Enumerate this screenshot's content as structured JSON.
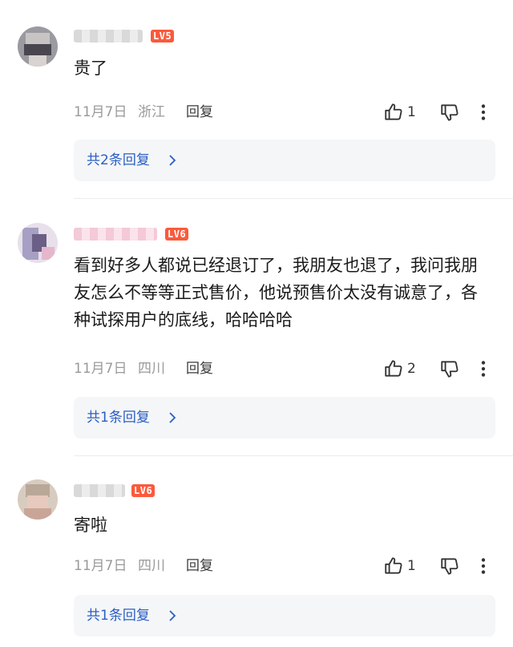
{
  "comments": [
    {
      "level_badge": "LV5",
      "text": "贵了",
      "date": "11月7日",
      "location": "浙江",
      "reply_label": "回复",
      "likes": "1",
      "replies_summary": "共2条回复"
    },
    {
      "level_badge": "LV6",
      "text": "看到好多人都说已经退订了，我朋友也退了，我问我朋友怎么不等等正式售价，他说预售价太没有诚意了，各种试探用户的底线，哈哈哈哈",
      "date": "11月7日",
      "location": "四川",
      "reply_label": "回复",
      "likes": "2",
      "replies_summary": "共1条回复"
    },
    {
      "level_badge": "LV6",
      "text": "寄啦",
      "date": "11月7日",
      "location": "四川",
      "reply_label": "回复",
      "likes": "1",
      "replies_summary": "共1条回复"
    }
  ],
  "icons": {
    "like": "thumb-up-icon",
    "dislike": "thumb-down-icon",
    "more": "more-vertical-icon",
    "chevron": "chevron-right-icon"
  },
  "colors": {
    "level_badge": "#fa5a3c",
    "reply_link": "#2a5fc4",
    "meta_text": "#9a9a9a",
    "reply_box_bg": "#f5f6f8"
  }
}
